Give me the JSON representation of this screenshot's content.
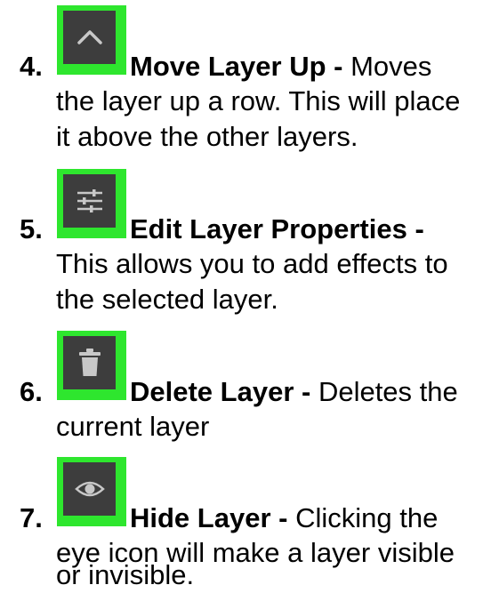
{
  "steps": [
    {
      "number": "4.",
      "icon": "chevron-up-icon",
      "title": "Move Layer Up -",
      "first_text": " Moves",
      "lines": [
        "the layer up a row. This will place",
        "it above the other layers."
      ]
    },
    {
      "number": "5.",
      "icon": "sliders-icon",
      "title": "Edit Layer Properties -",
      "first_text": "",
      "lines": [
        "This allows you to add effects to",
        "the selected layer."
      ]
    },
    {
      "number": "6.",
      "icon": "trash-icon",
      "title": "Delete Layer -",
      "first_text": " Deletes the",
      "lines": [
        "current layer"
      ]
    },
    {
      "number": "7.",
      "icon": "eye-icon",
      "title": "Hide Layer -",
      "first_text": " Clicking the",
      "lines": [
        "eye icon will make a layer visible",
        "or invisible."
      ]
    }
  ],
  "colors": {
    "icon_border": "#2ee62e",
    "icon_background": "#3d3d3d",
    "icon_glyph": "#c8c8c8"
  }
}
